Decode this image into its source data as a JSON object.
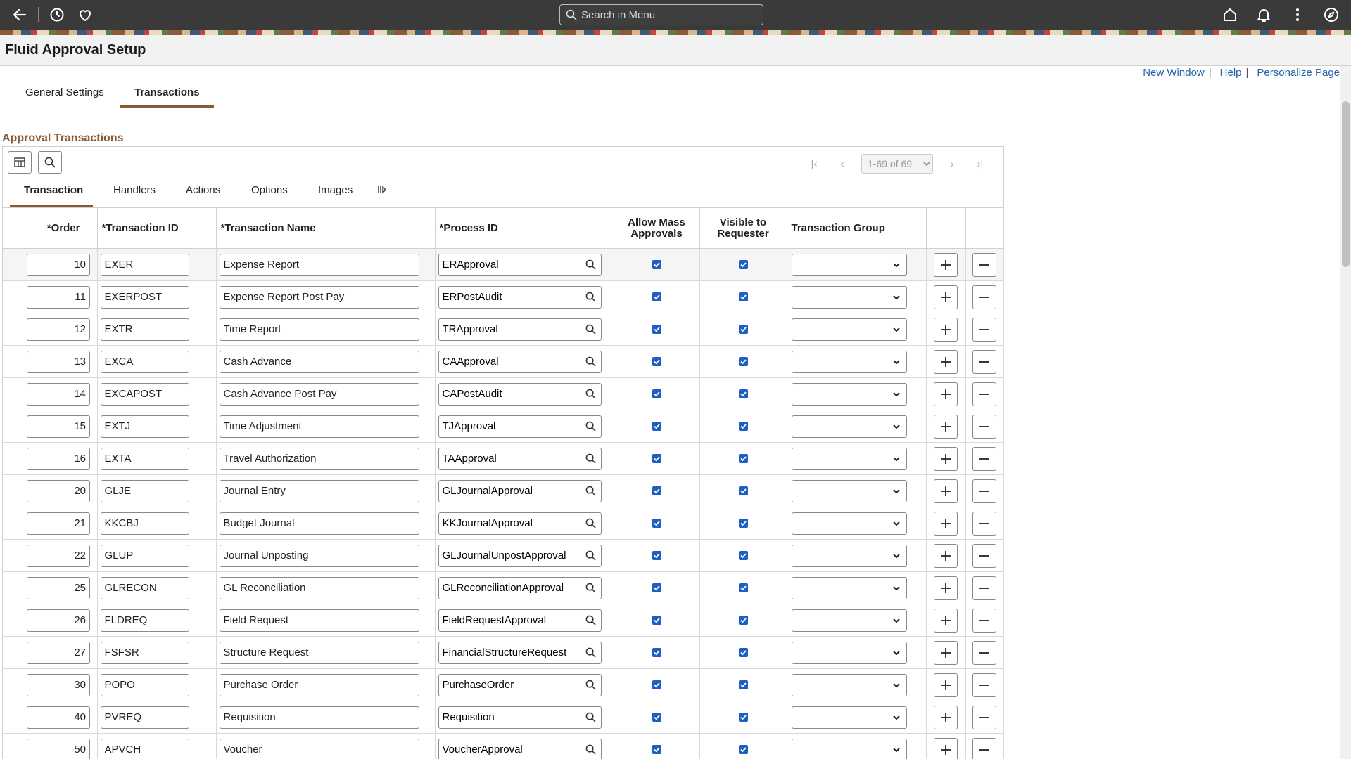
{
  "banner": {
    "search_placeholder": "Search in Menu",
    "icons_left": [
      "back-arrow-icon",
      "history-icon",
      "favorites-heart-icon"
    ],
    "icons_right": [
      "home-icon",
      "notifications-bell-icon",
      "actions-menu-icon",
      "navbar-compass-icon"
    ]
  },
  "page": {
    "title": "Fluid Approval Setup",
    "links": [
      "New Window",
      "Help",
      "Personalize Page"
    ]
  },
  "main_tabs": [
    {
      "label": "General Settings",
      "active": false
    },
    {
      "label": "Transactions",
      "active": true
    }
  ],
  "section_title": "Approval Transactions",
  "pager": {
    "range": "1-69 of 69"
  },
  "sub_tabs": [
    {
      "label": "Transaction",
      "active": true
    },
    {
      "label": "Handlers",
      "active": false
    },
    {
      "label": "Actions",
      "active": false
    },
    {
      "label": "Options",
      "active": false
    },
    {
      "label": "Images",
      "active": false
    }
  ],
  "columns": {
    "order": "Order",
    "transaction_id": "Transaction ID",
    "transaction_name": "Transaction Name",
    "process_id": "Process ID",
    "allow_mass": "Allow Mass Approvals",
    "visible": "Visible to Requester",
    "group": "Transaction Group",
    "required_mark": "*"
  },
  "rows": [
    {
      "order": "10",
      "tid": "EXER",
      "tname": "Expense Report",
      "pid": "ERApproval",
      "mass": true,
      "visible": true
    },
    {
      "order": "11",
      "tid": "EXERPOST",
      "tname": "Expense Report Post Pay",
      "pid": "ERPostAudit",
      "mass": true,
      "visible": true
    },
    {
      "order": "12",
      "tid": "EXTR",
      "tname": "Time Report",
      "pid": "TRApproval",
      "mass": true,
      "visible": true
    },
    {
      "order": "13",
      "tid": "EXCA",
      "tname": "Cash Advance",
      "pid": "CAApproval",
      "mass": true,
      "visible": true
    },
    {
      "order": "14",
      "tid": "EXCAPOST",
      "tname": "Cash Advance Post Pay",
      "pid": "CAPostAudit",
      "mass": true,
      "visible": true
    },
    {
      "order": "15",
      "tid": "EXTJ",
      "tname": "Time Adjustment",
      "pid": "TJApproval",
      "mass": true,
      "visible": true
    },
    {
      "order": "16",
      "tid": "EXTA",
      "tname": "Travel Authorization",
      "pid": "TAApproval",
      "mass": true,
      "visible": true
    },
    {
      "order": "20",
      "tid": "GLJE",
      "tname": "Journal Entry",
      "pid": "GLJournalApproval",
      "mass": true,
      "visible": true
    },
    {
      "order": "21",
      "tid": "KKCBJ",
      "tname": "Budget Journal",
      "pid": "KKJournalApproval",
      "mass": true,
      "visible": true
    },
    {
      "order": "22",
      "tid": "GLUP",
      "tname": "Journal Unposting",
      "pid": "GLJournalUnpostApproval",
      "mass": true,
      "visible": true
    },
    {
      "order": "25",
      "tid": "GLRECON",
      "tname": "GL Reconciliation",
      "pid": "GLReconciliationApproval",
      "mass": true,
      "visible": true
    },
    {
      "order": "26",
      "tid": "FLDREQ",
      "tname": "Field Request",
      "pid": "FieldRequestApproval",
      "mass": true,
      "visible": true
    },
    {
      "order": "27",
      "tid": "FSFSR",
      "tname": "Structure Request",
      "pid": "FinancialStructureRequest",
      "mass": true,
      "visible": true
    },
    {
      "order": "30",
      "tid": "POPO",
      "tname": "Purchase Order",
      "pid": "PurchaseOrder",
      "mass": true,
      "visible": true
    },
    {
      "order": "40",
      "tid": "PVREQ",
      "tname": "Requisition",
      "pid": "Requisition",
      "mass": true,
      "visible": true
    },
    {
      "order": "50",
      "tid": "APVCH",
      "tname": "Voucher",
      "pid": "VoucherApproval",
      "mass": true,
      "visible": true
    }
  ]
}
